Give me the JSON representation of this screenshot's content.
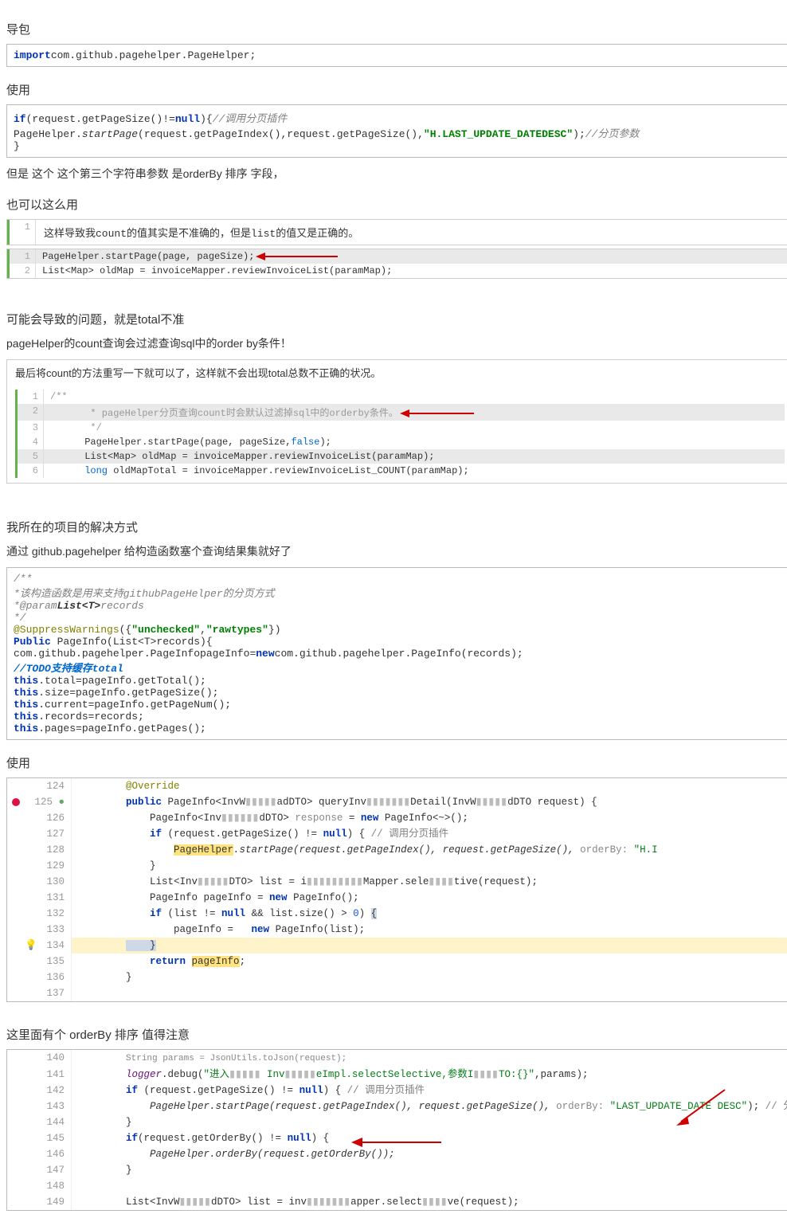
{
  "h1": "导包",
  "code1": {
    "import": "import",
    "pkg": "com.github.pagehelper.PageHelper;"
  },
  "h2": "使用",
  "code2": {
    "l1a": "if",
    "l1b": "(request.getPageSize()!=",
    "l1c": "null",
    "l1d": "){",
    "l1cmt": "//调用分页插件",
    "l2a": "PageHelper.",
    "l2b": "startPage",
    "l2c": "(request.getPageIndex(),request.getPageSize(),",
    "l2str": "\"H.LAST_UPDATE_DATEDESC\"",
    "l2d": ");",
    "l2cmt": "//分页参数",
    "l3": "}"
  },
  "p1": "但是 这个 这个第三个字符串参数 是orderBy 排序  字段，",
  "h3": "也可以这么用",
  "block1": {
    "note": "这样导致我count的值其实是不准确的，但是list的值又是正确的。",
    "line1": "PageHelper.startPage(page, pageSize);",
    "line2": "List<Map> oldMap = invoiceMapper.reviewInvoiceList(paramMap);"
  },
  "h4": "可能会导致的问题，就是total不准",
  "p2": "pageHelper的count查询会过滤查询sql中的order by条件！",
  "block2": {
    "note": "最后将count的方法重写一下就可以了，这样就不会出现total总数不正确的状况。",
    "l1": "/**",
    "l2": "       * pageHelper分页查询count时会默认过滤掉sql中的orderby条件。",
    "l3": "       */",
    "l4a": "      PageHelper.startPage(page, pageSize,",
    "l4b": "false",
    "l4c": ");",
    "l5": "      List<Map> oldMap = invoiceMapper.reviewInvoiceList(paramMap);",
    "l6a": "      long",
    "l6b": " oldMapTotal = invoiceMapper.reviewInvoiceList_COUNT(paramMap);"
  },
  "h5": "我所在的项目的解决方式",
  "p3": "通过 github.pagehelper  给构造函数塞个查询结果集就好了",
  "code3": {
    "l1": "/**",
    "l2": "*该构造函数是用来支持githubPageHelper的分页方式",
    "l3a": "*@param",
    "l3b": "List<T>",
    "l3c": "records",
    "l4": "*/",
    "l5a": "@SuppressWarnings",
    "l5b": "({",
    "l5s1": "\"unchecked\"",
    "l5c": ",",
    "l5s2": "\"rawtypes\"",
    "l5d": "})",
    "l6a": "Public",
    "l6b": " PageInfo(List<T>records){",
    "l7a": "com.github.pagehelper.PageInfopageInfo=",
    "l7b": "new",
    "l7c": "com.github.pagehelper.PageInfo(records);",
    "l8": "//TODO支持缓存total",
    "l9a": "this",
    "l9b": ".total=pageInfo.getTotal();",
    "l10a": "this",
    "l10b": ".size=pageInfo.getPageSize();",
    "l11a": "this",
    "l11b": ".current=pageInfo.getPageNum();",
    "l12a": "this",
    "l12b": ".records=records;",
    "l13a": "this",
    "l13b": ".pages=pageInfo.getPages();"
  },
  "h6": "使用",
  "ide1": {
    "start": 124,
    "l124": "@Override",
    "l125a": "public",
    "l125b": " PageInfo<InvW",
    "l125obf1": "▮▮▮▮▮",
    "l125c": "adDTO> queryInv",
    "l125obf2": "▮▮▮▮▮▮▮",
    "l125d": "Detail(InvW",
    "l125obf3": "▮▮▮▮▮",
    "l125e": "dDTO request) {",
    "l126a": "    PageInfo<Inv",
    "l126obf": "▮▮▮▮▮▮",
    "l126b": "dDTO> ",
    "l126g": "response",
    "l126c": " = ",
    "l126d": "new",
    "l126e": " PageInfo<~>();",
    "l127a": "    if",
    "l127b": " (request.getPageSize() != ",
    "l127c": "null",
    "l127d": ") { ",
    "l127cmt": "// 调用分页插件",
    "l128a": "        ",
    "l128hl": "PageHelper",
    "l128b": ".startPage(request.getPageIndex(), request.getPageSize(), ",
    "l128hint": "orderBy: ",
    "l128str": "\"H.I",
    "l129": "    }",
    "l130a": "    List<Inv",
    "l130ob1": "▮▮▮▮▮",
    "l130b": "DTO> list = i",
    "l130ob2": "▮▮▮▮▮▮▮▮▮",
    "l130c": "Mapper.sele",
    "l130ob3": "▮▮▮▮",
    "l130d": "tive(request);",
    "l131a": "    PageInfo pageInfo = ",
    "l131b": "new",
    "l131c": " PageInfo();",
    "l132a": "    if",
    "l132b": " (list != ",
    "l132c": "null",
    "l132d": " && list.size() > ",
    "l132e": "0",
    "l132f": ") ",
    "l132g": "{",
    "l133a": "        pageInfo =   ",
    "l133b": "new",
    "l133c": " PageInfo(list);",
    "l134": "    }",
    "l135a": "    return",
    "l135b": " ",
    "l135c": "pageInfo",
    "l135d": ";",
    "l136": "}"
  },
  "h7": "这里面有个 orderBy 排序 值得注意",
  "ide2": {
    "l140": "String params = JsonUtils.toJson(request);",
    "l141a": "logger",
    "l141b": ".debug(",
    "l141s1": "\"进入",
    "l141obf": "▮▮▮▮▮",
    "l141s2": " Inv",
    "l141obf2": "▮▮▮▮▮",
    "l141s3": "eImpl.selectSelective,参数I",
    "l141obf3": "▮▮▮▮",
    "l141s4": "TO:{}\"",
    "l141c": ",params);",
    "l142a": "if",
    "l142b": " (request.getPageSize() != ",
    "l142c": "null",
    "l142d": ") { ",
    "l142cmt": "// 调用分页插件",
    "l143a": "    PageHelper.startPage(request.getPageIndex(), request.getPageSize(), ",
    "l143hint": "orderBy: ",
    "l143str": "\"LAST_UPDATE_DATE DESC\"",
    "l143b": "); ",
    "l143cmt": "// 分页参数",
    "l144": "}",
    "l145a": "if",
    "l145b": "(request.getOrderBy() != ",
    "l145c": "null",
    "l145d": ") {",
    "l146": "    PageHelper.orderBy(request.getOrderBy());",
    "l147": "}",
    "l148": "",
    "l149a": "List<InvW",
    "l149ob1": "▮▮▮▮▮",
    "l149b": "dDTO> list = inv",
    "l149ob2": "▮▮▮▮▮▮▮",
    "l149c": "apper.select",
    "l149ob3": "▮▮▮▮",
    "l149d": "ve(request);"
  }
}
